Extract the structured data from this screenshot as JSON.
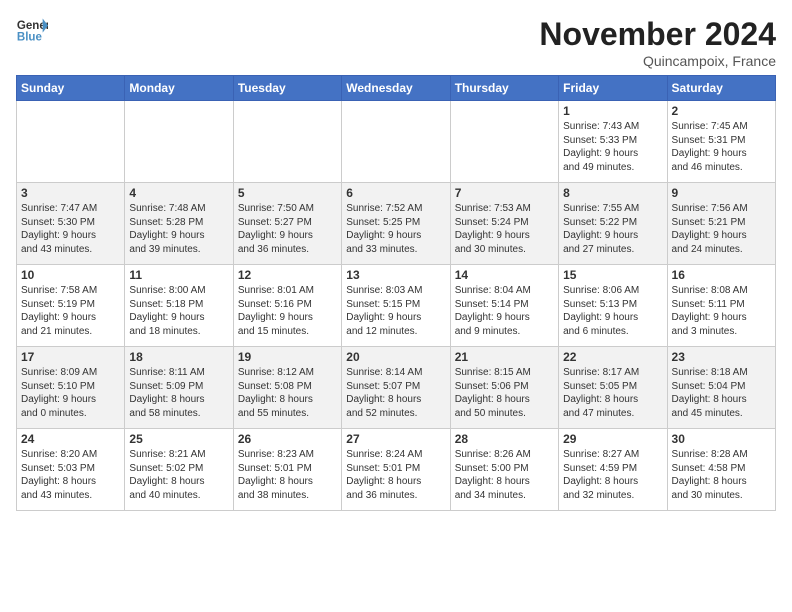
{
  "header": {
    "logo_general": "General",
    "logo_blue": "Blue",
    "month_title": "November 2024",
    "location": "Quincampoix, France"
  },
  "weekdays": [
    "Sunday",
    "Monday",
    "Tuesday",
    "Wednesday",
    "Thursday",
    "Friday",
    "Saturday"
  ],
  "weeks": [
    [
      {
        "day": "",
        "info": ""
      },
      {
        "day": "",
        "info": ""
      },
      {
        "day": "",
        "info": ""
      },
      {
        "day": "",
        "info": ""
      },
      {
        "day": "",
        "info": ""
      },
      {
        "day": "1",
        "info": "Sunrise: 7:43 AM\nSunset: 5:33 PM\nDaylight: 9 hours\nand 49 minutes."
      },
      {
        "day": "2",
        "info": "Sunrise: 7:45 AM\nSunset: 5:31 PM\nDaylight: 9 hours\nand 46 minutes."
      }
    ],
    [
      {
        "day": "3",
        "info": "Sunrise: 7:47 AM\nSunset: 5:30 PM\nDaylight: 9 hours\nand 43 minutes."
      },
      {
        "day": "4",
        "info": "Sunrise: 7:48 AM\nSunset: 5:28 PM\nDaylight: 9 hours\nand 39 minutes."
      },
      {
        "day": "5",
        "info": "Sunrise: 7:50 AM\nSunset: 5:27 PM\nDaylight: 9 hours\nand 36 minutes."
      },
      {
        "day": "6",
        "info": "Sunrise: 7:52 AM\nSunset: 5:25 PM\nDaylight: 9 hours\nand 33 minutes."
      },
      {
        "day": "7",
        "info": "Sunrise: 7:53 AM\nSunset: 5:24 PM\nDaylight: 9 hours\nand 30 minutes."
      },
      {
        "day": "8",
        "info": "Sunrise: 7:55 AM\nSunset: 5:22 PM\nDaylight: 9 hours\nand 27 minutes."
      },
      {
        "day": "9",
        "info": "Sunrise: 7:56 AM\nSunset: 5:21 PM\nDaylight: 9 hours\nand 24 minutes."
      }
    ],
    [
      {
        "day": "10",
        "info": "Sunrise: 7:58 AM\nSunset: 5:19 PM\nDaylight: 9 hours\nand 21 minutes."
      },
      {
        "day": "11",
        "info": "Sunrise: 8:00 AM\nSunset: 5:18 PM\nDaylight: 9 hours\nand 18 minutes."
      },
      {
        "day": "12",
        "info": "Sunrise: 8:01 AM\nSunset: 5:16 PM\nDaylight: 9 hours\nand 15 minutes."
      },
      {
        "day": "13",
        "info": "Sunrise: 8:03 AM\nSunset: 5:15 PM\nDaylight: 9 hours\nand 12 minutes."
      },
      {
        "day": "14",
        "info": "Sunrise: 8:04 AM\nSunset: 5:14 PM\nDaylight: 9 hours\nand 9 minutes."
      },
      {
        "day": "15",
        "info": "Sunrise: 8:06 AM\nSunset: 5:13 PM\nDaylight: 9 hours\nand 6 minutes."
      },
      {
        "day": "16",
        "info": "Sunrise: 8:08 AM\nSunset: 5:11 PM\nDaylight: 9 hours\nand 3 minutes."
      }
    ],
    [
      {
        "day": "17",
        "info": "Sunrise: 8:09 AM\nSunset: 5:10 PM\nDaylight: 9 hours\nand 0 minutes."
      },
      {
        "day": "18",
        "info": "Sunrise: 8:11 AM\nSunset: 5:09 PM\nDaylight: 8 hours\nand 58 minutes."
      },
      {
        "day": "19",
        "info": "Sunrise: 8:12 AM\nSunset: 5:08 PM\nDaylight: 8 hours\nand 55 minutes."
      },
      {
        "day": "20",
        "info": "Sunrise: 8:14 AM\nSunset: 5:07 PM\nDaylight: 8 hours\nand 52 minutes."
      },
      {
        "day": "21",
        "info": "Sunrise: 8:15 AM\nSunset: 5:06 PM\nDaylight: 8 hours\nand 50 minutes."
      },
      {
        "day": "22",
        "info": "Sunrise: 8:17 AM\nSunset: 5:05 PM\nDaylight: 8 hours\nand 47 minutes."
      },
      {
        "day": "23",
        "info": "Sunrise: 8:18 AM\nSunset: 5:04 PM\nDaylight: 8 hours\nand 45 minutes."
      }
    ],
    [
      {
        "day": "24",
        "info": "Sunrise: 8:20 AM\nSunset: 5:03 PM\nDaylight: 8 hours\nand 43 minutes."
      },
      {
        "day": "25",
        "info": "Sunrise: 8:21 AM\nSunset: 5:02 PM\nDaylight: 8 hours\nand 40 minutes."
      },
      {
        "day": "26",
        "info": "Sunrise: 8:23 AM\nSunset: 5:01 PM\nDaylight: 8 hours\nand 38 minutes."
      },
      {
        "day": "27",
        "info": "Sunrise: 8:24 AM\nSunset: 5:01 PM\nDaylight: 8 hours\nand 36 minutes."
      },
      {
        "day": "28",
        "info": "Sunrise: 8:26 AM\nSunset: 5:00 PM\nDaylight: 8 hours\nand 34 minutes."
      },
      {
        "day": "29",
        "info": "Sunrise: 8:27 AM\nSunset: 4:59 PM\nDaylight: 8 hours\nand 32 minutes."
      },
      {
        "day": "30",
        "info": "Sunrise: 8:28 AM\nSunset: 4:58 PM\nDaylight: 8 hours\nand 30 minutes."
      }
    ]
  ]
}
